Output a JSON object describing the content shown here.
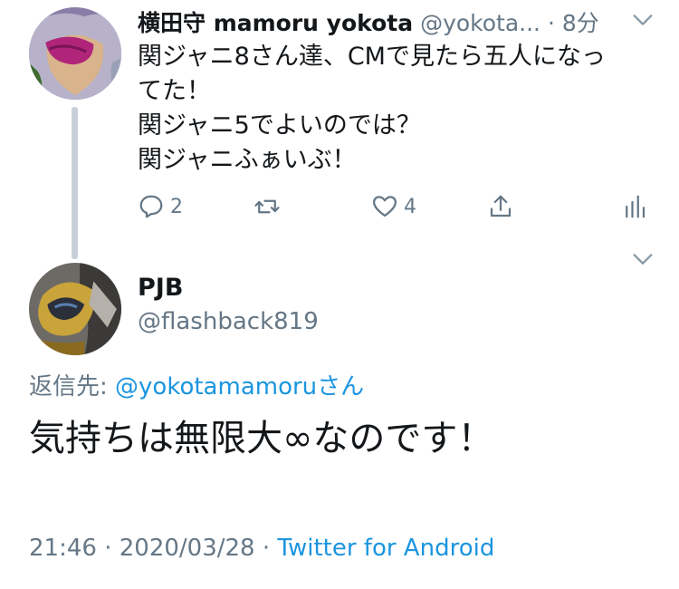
{
  "parent_tweet": {
    "author_name": "横田守 mamoru yokota",
    "author_handle": "@yokota...",
    "time": " · 8分",
    "lines": [
      "関ジャニ8さん達、CMで見たら五人になっ",
      "てた！",
      "関ジャニ5でよいのでは？",
      "関ジャニふぁいぶ！"
    ],
    "actions": {
      "reply_count": "2",
      "retweet_count": "",
      "like_count": "4"
    },
    "icons": [
      "reply-icon",
      "retweet-icon",
      "like-icon",
      "share-icon",
      "analytics-icon",
      "chevron-down-icon"
    ]
  },
  "reply_tweet": {
    "author_name": "PJB",
    "author_handle": "@flashback819",
    "replying_prefix": "返信先: ",
    "replying_mention": "@yokotamamoru",
    "replying_suffix": "さん",
    "text": "気持ちは無限大∞なのです！",
    "time": "21:46",
    "separator1": " · ",
    "date": "2020/03/28",
    "separator2": " · ",
    "source": "Twitter for Android"
  },
  "colors": {
    "text": "#14171a",
    "secondary": "#657786",
    "link": "#1b95e0",
    "thread_line": "#c7d0d8"
  }
}
